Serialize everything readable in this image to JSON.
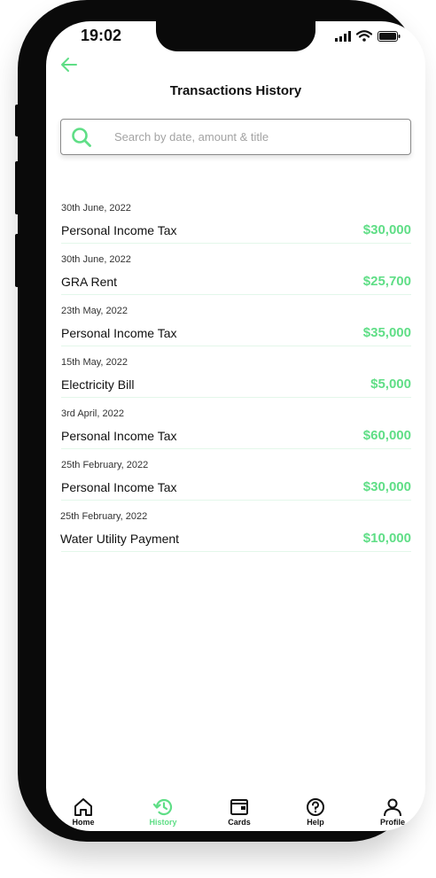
{
  "status_bar": {
    "time": "19:02"
  },
  "header": {
    "title": "Transactions History"
  },
  "search": {
    "placeholder": "Search by date, amount & title"
  },
  "transactions": [
    {
      "date": "30th June, 2022",
      "title": "Personal Income Tax",
      "amount": "$30,000"
    },
    {
      "date": "30th June, 2022",
      "title": "GRA Rent",
      "amount": "$25,700"
    },
    {
      "date": "23th May, 2022",
      "title": "Personal Income Tax",
      "amount": "$35,000"
    },
    {
      "date": "15th May, 2022",
      "title": "Electricity Bill",
      "amount": "$5,000"
    },
    {
      "date": "3rd April, 2022",
      "title": "Personal Income Tax",
      "amount": "$60,000"
    },
    {
      "date": "25th February, 2022",
      "title": "Personal Income Tax",
      "amount": "$30,000"
    },
    {
      "date": "25th February, 2022",
      "title": "Water Utility Payment",
      "amount": "$10,000"
    }
  ],
  "nav": {
    "items": [
      {
        "label": "Home",
        "icon": "home-icon",
        "active": false
      },
      {
        "label": "History",
        "icon": "history-icon",
        "active": true
      },
      {
        "label": "Cards",
        "icon": "wallet-icon",
        "active": false
      },
      {
        "label": "Help",
        "icon": "help-icon",
        "active": false
      },
      {
        "label": "Profile",
        "icon": "profile-icon",
        "active": false
      }
    ]
  },
  "colors": {
    "accent": "#5fde86",
    "text": "#111111",
    "divider": "#e3f7ea"
  }
}
